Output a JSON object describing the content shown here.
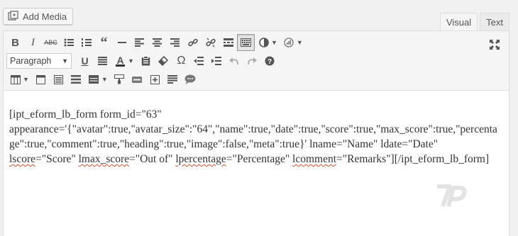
{
  "media": {
    "add_media_label": "Add Media"
  },
  "tabs": [
    {
      "label": "Visual"
    },
    {
      "label": "Text"
    }
  ],
  "toolbar": {
    "row1": [
      "bold-icon",
      "italic-icon",
      "strikethrough-icon",
      "bullet-list-icon",
      "numbered-list-icon",
      "blockquote-icon",
      "horizontal-line-icon",
      "align-left-icon",
      "align-center-icon",
      "align-right-icon",
      "link-icon",
      "unlink-icon",
      "read-more-icon",
      "toolbar-toggle-icon",
      "contrast-icon",
      "plugin-icon"
    ],
    "format_select": {
      "selected": "Paragraph"
    },
    "row2": [
      "underline-icon",
      "justify-icon",
      "text-color-icon",
      "paste-text-icon",
      "clear-formatting-icon",
      "special-character-icon",
      "outdent-icon",
      "indent-icon",
      "undo-icon",
      "redo-icon",
      "help-icon"
    ],
    "row3": [
      "table-icon",
      "page-icon",
      "columns-icon",
      "list-icon",
      "insert-icon",
      "brush-icon",
      "label-icon",
      "add-block-icon",
      "paragraph-icon",
      "comment-icon"
    ],
    "fullscreen": "fullscreen-icon"
  },
  "content": {
    "line1": "[ipt_eform_lb_form form_id=\"63\"",
    "line2": "appearance='{\"avatar\":true,\"avatar_size\":\"64\",\"name\":true,\"date\":true,\"score\":true,\"max_score\":true,\"percenta",
    "line3": "ge\":true,\"comment\":true,\"heading\":true,\"image\":false,\"meta\":true}' lname=\"Name\" ldate=\"Date\"",
    "line4_a": "lscore",
    "line4_b": "=\"Score\" ",
    "line4_c": "lmax_score",
    "line4_d": "=\"Out of\" ",
    "line4_e": "lpercentage",
    "line4_f": "=\"Percentage\" ",
    "line4_g": "lcomment",
    "line4_h": "=\"Remarks\"][/ipt_eform_lb_form]"
  },
  "watermark": {
    "text": "7P"
  }
}
